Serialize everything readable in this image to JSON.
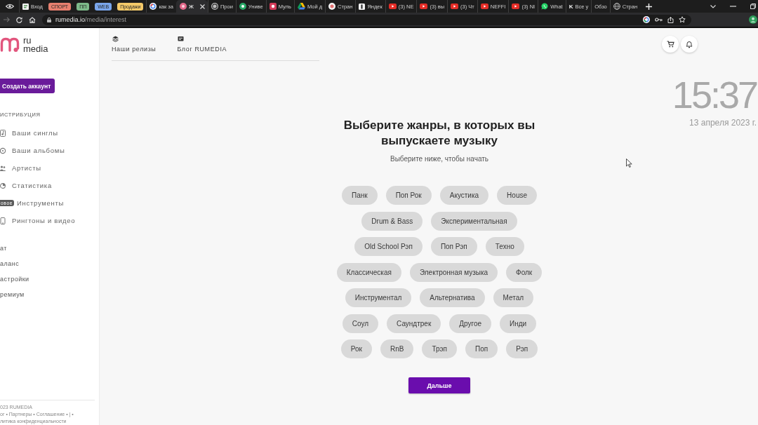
{
  "browser": {
    "tab_strip": [
      {
        "kind": "pinned",
        "selected": false
      },
      {
        "kind": "tab",
        "title": "Вход",
        "selected": false
      },
      {
        "kind": "group",
        "title": "СПОРТ",
        "color": "#e8806f"
      },
      {
        "kind": "group",
        "title": "ПП",
        "color": "#7dba8a"
      },
      {
        "kind": "group",
        "title": "WEB",
        "color": "#7aa6ec"
      },
      {
        "kind": "group",
        "title": "Продажи",
        "color": "#f3c969"
      },
      {
        "kind": "tab",
        "title": "как за",
        "selected": false
      },
      {
        "kind": "tab",
        "title": "Ж",
        "selected": true
      },
      {
        "kind": "tab",
        "title": "Прои",
        "selected": false
      },
      {
        "kind": "tab",
        "title": "Униве",
        "selected": false
      },
      {
        "kind": "tab",
        "title": "Муль",
        "selected": false
      },
      {
        "kind": "tab",
        "title": "Мой д",
        "selected": false
      },
      {
        "kind": "tab",
        "title": "Стран",
        "selected": false
      },
      {
        "kind": "tab",
        "title": "Яндек",
        "selected": false
      },
      {
        "kind": "tab",
        "title": "(3) NE",
        "selected": false
      },
      {
        "kind": "tab",
        "title": "(3) вы",
        "selected": false
      },
      {
        "kind": "tab",
        "title": "(3) Чт",
        "selected": false
      },
      {
        "kind": "tab",
        "title": "NEFFI",
        "selected": false
      },
      {
        "kind": "tab",
        "title": "(3) NI",
        "selected": false
      },
      {
        "kind": "tab",
        "title": "What",
        "selected": false
      },
      {
        "kind": "tab",
        "title": "Все у",
        "glyph": "K",
        "selected": false
      },
      {
        "kind": "tab",
        "title": "Обзо",
        "selected": false
      },
      {
        "kind": "tab",
        "title": "Стран",
        "selected": false
      }
    ],
    "address_bar": {
      "domain": "rumedia.io",
      "path": "/media/interest"
    }
  },
  "sidebar": {
    "logo": {
      "line_1": "ru",
      "line_2": "media"
    },
    "create_account_button": "Создать аккаунт",
    "section_title": "ИСТРИБУЦИЯ",
    "nav_items": [
      {
        "label": "Ваши синглы",
        "selected": false
      },
      {
        "label": "Ваши альбомы",
        "selected": false
      },
      {
        "label": "Артисты",
        "selected": false
      },
      {
        "label": "Статистика",
        "selected": false
      },
      {
        "label": "Инструменты",
        "badge": "овое",
        "selected": false
      },
      {
        "label": "Рингтоны и видео",
        "selected": false
      }
    ],
    "links": [
      "ат",
      "аланс",
      "астройки",
      "ремиум"
    ],
    "footer": [
      "023 RUMEDIA",
      "ог • Партнеры • Соглашение • | •",
      "литика конфиденциальности"
    ]
  },
  "top_nav": [
    {
      "label": "Наши релизы",
      "selected": false
    },
    {
      "label": "Блог RUMEDIA",
      "selected": false
    }
  ],
  "clock": {
    "time": "15:37",
    "date": "13 апреля 2023 г."
  },
  "genre_picker": {
    "title": "Выберите жанры, в которых вы выпускаете музыку",
    "subtitle": "Выберите ниже, чтобы начать",
    "rows": [
      [
        {
          "label": "Панк",
          "selected": false
        },
        {
          "label": "Поп Рок",
          "selected": false
        },
        {
          "label": "Акустика",
          "selected": false
        },
        {
          "label": "House",
          "selected": false
        }
      ],
      [
        {
          "label": "Drum & Bass",
          "selected": false
        },
        {
          "label": "Экспериментальная",
          "selected": false
        }
      ],
      [
        {
          "label": "Old School Рэп",
          "selected": false
        },
        {
          "label": "Поп Рэп",
          "selected": false
        },
        {
          "label": "Техно",
          "selected": false
        }
      ],
      [
        {
          "label": "Классическая",
          "selected": false
        },
        {
          "label": "Электронная музыка",
          "selected": false
        },
        {
          "label": "Фолк",
          "selected": false
        }
      ],
      [
        {
          "label": "Инструментал",
          "selected": false
        },
        {
          "label": "Альтернатива",
          "selected": false
        },
        {
          "label": "Метал",
          "selected": false
        }
      ],
      [
        {
          "label": "Соул",
          "selected": false
        },
        {
          "label": "Саундтрек",
          "selected": false
        },
        {
          "label": "Другое",
          "selected": false
        },
        {
          "label": "Инди",
          "selected": false
        }
      ],
      [
        {
          "label": "Рок",
          "selected": false
        },
        {
          "label": "RnB",
          "selected": false
        },
        {
          "label": "Трэп",
          "selected": false
        },
        {
          "label": "Поп",
          "selected": false
        },
        {
          "label": "Рэп",
          "selected": false
        }
      ]
    ],
    "next_button": "Дальше"
  }
}
